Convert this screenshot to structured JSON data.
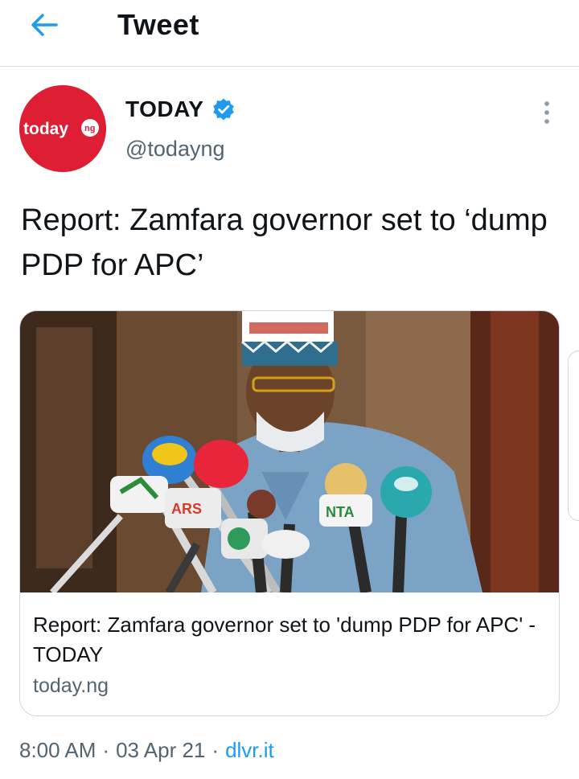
{
  "header": {
    "title": "Tweet",
    "back_icon": "arrow-left-icon"
  },
  "author": {
    "avatar_text": "today",
    "avatar_badge": "ng",
    "display_name": "TODAY",
    "handle": "@todayng",
    "verified_icon": "verified-badge-icon",
    "more_icon": "more-vertical-icon"
  },
  "tweet": {
    "text": "Report: Zamfara governor set to ‘dump PDP for APC’"
  },
  "link_card": {
    "title": "Report: Zamfara governor set to 'dump PDP for APC' - TODAY",
    "domain": "today.ng",
    "image_icon": "press-conference-photo"
  },
  "meta": {
    "time": "8:00 AM",
    "date": "03 Apr 21",
    "separator": "·",
    "source": "dlvr.it"
  },
  "colors": {
    "accent": "#1d9bf0",
    "brand_red": "#dd1e35",
    "secondary_text": "#536471"
  }
}
